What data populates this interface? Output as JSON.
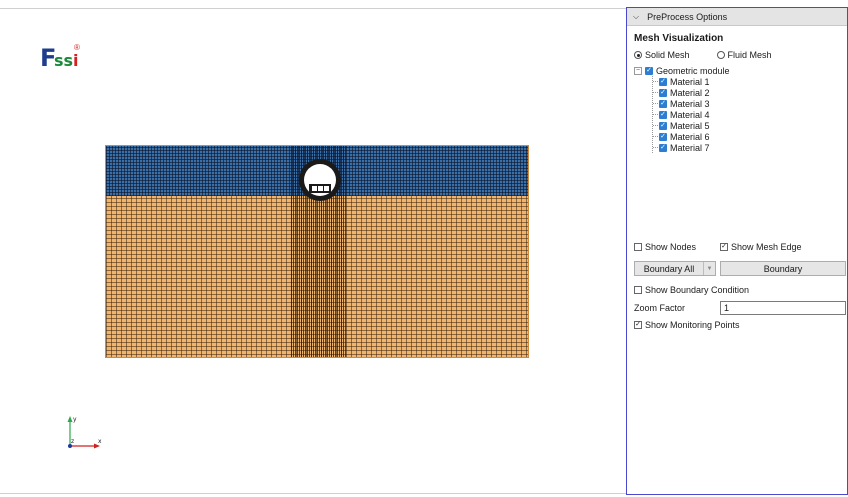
{
  "logo": {
    "f": "F",
    "ssi_s": "ss",
    "ssi_i": "i",
    "reg": "®"
  },
  "axes": {
    "y": "y",
    "z": "z",
    "x": "x"
  },
  "panel": {
    "title": "PreProcess Options",
    "section_title": "Mesh Visualization",
    "radios": {
      "solid": "Solid Mesh",
      "fluid": "Fluid Mesh",
      "selected": "solid"
    },
    "tree": {
      "root": "Geometric module",
      "items": [
        "Material 1",
        "Material 2",
        "Material 3",
        "Material 4",
        "Material 5",
        "Material 6",
        "Material 7"
      ]
    },
    "show_nodes": "Show Nodes",
    "show_mesh_edge": "Show Mesh Edge",
    "boundary_combo": "Boundary All",
    "boundary_button": "Boundary",
    "show_boundary_condition": "Show Boundary Condition",
    "zoom_label": "Zoom Factor",
    "zoom_value": "1",
    "show_monitoring_points": "Show Monitoring Points"
  },
  "colors": {
    "panel_border": "#4b48d0",
    "checkbox": "#2b7ed1",
    "soil": "#f2b36b",
    "water": "#3b6fa8"
  }
}
